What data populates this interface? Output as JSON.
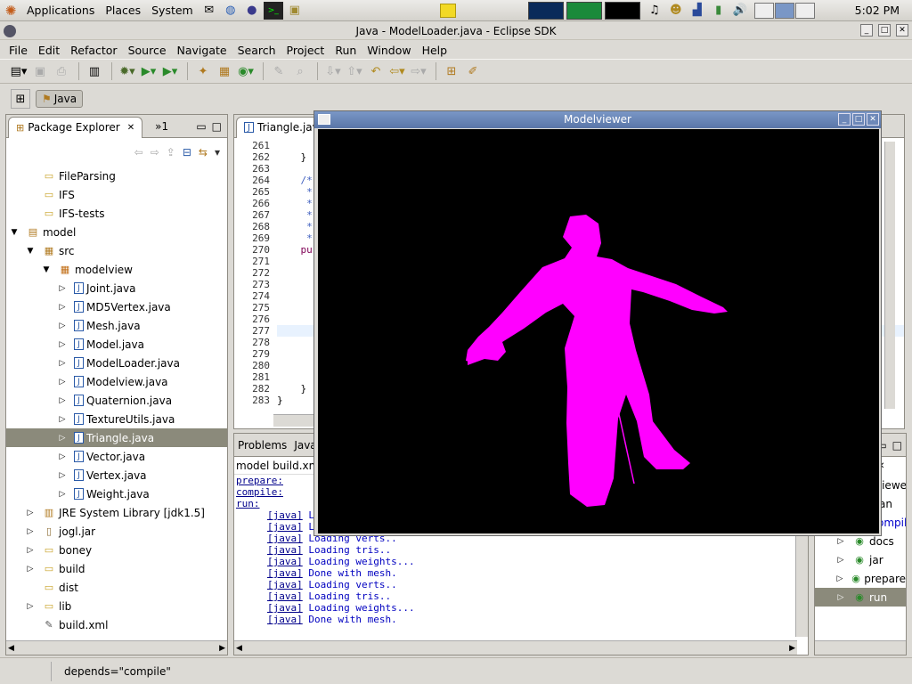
{
  "panel": {
    "apps": "Applications",
    "places": "Places",
    "system": "System",
    "clock": "5:02 PM"
  },
  "window": {
    "title": "Java - ModelLoader.java - Eclipse SDK"
  },
  "menu": [
    "File",
    "Edit",
    "Refactor",
    "Source",
    "Navigate",
    "Search",
    "Project",
    "Run",
    "Window",
    "Help"
  ],
  "perspective": {
    "label": "Java"
  },
  "explorer": {
    "tab": "Package Explorer",
    "tab2": "»1",
    "items": [
      {
        "label": "FileParsing",
        "depth": 1,
        "icon": "folder-icon",
        "arrow": ""
      },
      {
        "label": "IFS",
        "depth": 1,
        "icon": "folder-icon",
        "arrow": ""
      },
      {
        "label": "IFS-tests",
        "depth": 1,
        "icon": "folder-icon",
        "arrow": ""
      },
      {
        "label": "model",
        "depth": 0,
        "icon": "project-icon",
        "arrow": "open"
      },
      {
        "label": "src",
        "depth": 1,
        "icon": "source-folder-icon",
        "arrow": "open"
      },
      {
        "label": "modelview",
        "depth": 2,
        "icon": "package-icon",
        "arrow": "open"
      },
      {
        "label": "Joint.java",
        "depth": 3,
        "icon": "java-file-icon",
        "arrow": "closed"
      },
      {
        "label": "MD5Vertex.java",
        "depth": 3,
        "icon": "java-file-icon",
        "arrow": "closed"
      },
      {
        "label": "Mesh.java",
        "depth": 3,
        "icon": "java-file-icon",
        "arrow": "closed"
      },
      {
        "label": "Model.java",
        "depth": 3,
        "icon": "java-file-icon",
        "arrow": "closed"
      },
      {
        "label": "ModelLoader.java",
        "depth": 3,
        "icon": "java-file-icon",
        "arrow": "closed"
      },
      {
        "label": "Modelview.java",
        "depth": 3,
        "icon": "java-file-icon",
        "arrow": "closed"
      },
      {
        "label": "Quaternion.java",
        "depth": 3,
        "icon": "java-file-icon",
        "arrow": "closed"
      },
      {
        "label": "TextureUtils.java",
        "depth": 3,
        "icon": "java-file-icon",
        "arrow": "closed"
      },
      {
        "label": "Triangle.java",
        "depth": 3,
        "icon": "java-file-icon",
        "arrow": "closed",
        "selected": true
      },
      {
        "label": "Vector.java",
        "depth": 3,
        "icon": "java-file-icon",
        "arrow": "closed"
      },
      {
        "label": "Vertex.java",
        "depth": 3,
        "icon": "java-file-icon",
        "arrow": "closed"
      },
      {
        "label": "Weight.java",
        "depth": 3,
        "icon": "java-file-icon",
        "arrow": "closed"
      },
      {
        "label": "JRE System Library [jdk1.5]",
        "depth": 1,
        "icon": "library-icon",
        "arrow": "closed"
      },
      {
        "label": "jogl.jar",
        "depth": 1,
        "icon": "jar-icon",
        "arrow": "closed"
      },
      {
        "label": "boney",
        "depth": 1,
        "icon": "folder-icon",
        "arrow": "closed"
      },
      {
        "label": "build",
        "depth": 1,
        "icon": "folder-icon",
        "arrow": "closed"
      },
      {
        "label": "dist",
        "depth": 1,
        "icon": "folder-icon",
        "arrow": ""
      },
      {
        "label": "lib",
        "depth": 1,
        "icon": "folder-icon",
        "arrow": "closed"
      },
      {
        "label": "build.xml",
        "depth": 1,
        "icon": "xml-file-icon",
        "arrow": ""
      }
    ]
  },
  "editor": {
    "tab": "Triangle.java",
    "lines": [
      {
        "n": "261",
        "t": ""
      },
      {
        "n": "262",
        "t": "    }"
      },
      {
        "n": "263",
        "t": ""
      },
      {
        "n": "264",
        "t": "    /*"
      },
      {
        "n": "265",
        "t": "     *"
      },
      {
        "n": "266",
        "t": "     *"
      },
      {
        "n": "267",
        "t": "     *"
      },
      {
        "n": "268",
        "t": "     *"
      },
      {
        "n": "269",
        "t": "     *"
      },
      {
        "n": "270",
        "t": "    pu"
      },
      {
        "n": "271",
        "t": ""
      },
      {
        "n": "272",
        "t": ""
      },
      {
        "n": "273",
        "t": ""
      },
      {
        "n": "274",
        "t": ""
      },
      {
        "n": "275",
        "t": ""
      },
      {
        "n": "276",
        "t": ""
      },
      {
        "n": "277",
        "t": ""
      },
      {
        "n": "278",
        "t": ""
      },
      {
        "n": "279",
        "t": ""
      },
      {
        "n": "280",
        "t": ""
      },
      {
        "n": "281",
        "t": ""
      },
      {
        "n": "282",
        "t": "    }"
      },
      {
        "n": "283",
        "t": "}"
      }
    ]
  },
  "console": {
    "tab1": "Problems",
    "tab2": "Java",
    "header": "model build.xm",
    "targets": [
      "prepare:",
      "compile:",
      "run:"
    ],
    "lines": [
      {
        "tag": "[java]",
        "msg": " L"
      },
      {
        "tag": "[java]",
        "msg": " L"
      },
      {
        "tag": "[java]",
        "msg": " Loading verts.."
      },
      {
        "tag": "[java]",
        "msg": " Loading tris.."
      },
      {
        "tag": "[java]",
        "msg": " Loading weights..."
      },
      {
        "tag": "[java]",
        "msg": " Done with mesh."
      },
      {
        "tag": "[java]",
        "msg": " Loading verts.."
      },
      {
        "tag": "[java]",
        "msg": " Loading tris.."
      },
      {
        "tag": "[java]",
        "msg": " Loading weights..."
      },
      {
        "tag": "[java]",
        "msg": " Done with mesh."
      }
    ]
  },
  "ant": {
    "frag1": "viewe",
    "frag2": "an",
    "frag3": "ompile",
    "targets": [
      {
        "label": "docs"
      },
      {
        "label": "jar"
      },
      {
        "label": "prepare"
      },
      {
        "label": "run",
        "selected": true
      }
    ]
  },
  "modelviewer": {
    "title": "Modelviewer",
    "figure_color": "#ff00ff",
    "background": "#000000"
  },
  "status": {
    "text": "depends=\"compile\""
  }
}
